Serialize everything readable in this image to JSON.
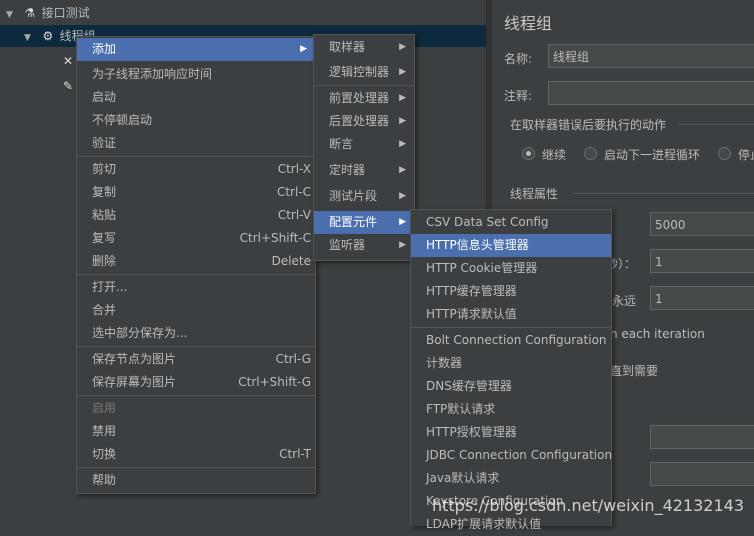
{
  "tree": {
    "root_label": "接口测试",
    "thread_group_label": "线程组"
  },
  "right_panel": {
    "title": "线程组",
    "name_label": "名称:",
    "name_value": "线程组",
    "comment_label": "注释:",
    "error_action_label": "在取样器错误后要执行的动作",
    "radio_continue": "继续",
    "radio_next_loop": "启动下一进程循环",
    "radio_stop": "停止",
    "thread_props_label": "线程属性",
    "threads_value": "5000",
    "ramp_label_partial": "秒）：",
    "ramp_value": "1",
    "loop_label_partial": "永远",
    "loop_value": "1",
    "same_user_partial": "n each iteration",
    "delay_partial": "直到需要"
  },
  "menu1": {
    "items": [
      {
        "label": "添加",
        "shortcut": "",
        "submenu": true,
        "highlight": true
      },
      {
        "label": "为子线程添加响应时间",
        "shortcut": ""
      },
      {
        "label": "启动",
        "shortcut": ""
      },
      {
        "label": "不停顿启动",
        "shortcut": ""
      },
      {
        "label": "验证",
        "shortcut": ""
      },
      {
        "label": "剪切",
        "shortcut": "Ctrl-X"
      },
      {
        "label": "复制",
        "shortcut": "Ctrl-C"
      },
      {
        "label": "粘贴",
        "shortcut": "Ctrl-V"
      },
      {
        "label": "复写",
        "shortcut": "Ctrl+Shift-C"
      },
      {
        "label": "删除",
        "shortcut": "Delete"
      },
      {
        "label": "打开...",
        "shortcut": ""
      },
      {
        "label": "合并",
        "shortcut": ""
      },
      {
        "label": "选中部分保存为...",
        "shortcut": ""
      },
      {
        "label": "保存节点为图片",
        "shortcut": "Ctrl-G"
      },
      {
        "label": "保存屏幕为图片",
        "shortcut": "Ctrl+Shift-G"
      },
      {
        "label": "启用",
        "shortcut": "",
        "disabled": true
      },
      {
        "label": "禁用",
        "shortcut": ""
      },
      {
        "label": "切换",
        "shortcut": "Ctrl-T"
      },
      {
        "label": "帮助",
        "shortcut": ""
      }
    ]
  },
  "menu2": {
    "items": [
      {
        "label": "取样器"
      },
      {
        "label": "逻辑控制器"
      },
      {
        "label": "前置处理器"
      },
      {
        "label": "后置处理器"
      },
      {
        "label": "断言"
      },
      {
        "label": "定时器"
      },
      {
        "label": "测试片段"
      },
      {
        "label": "配置元件",
        "highlight": true
      },
      {
        "label": "监听器"
      }
    ]
  },
  "menu3": {
    "items": [
      {
        "label": "CSV Data Set Config"
      },
      {
        "label": "HTTP信息头管理器",
        "highlight": true
      },
      {
        "label": "HTTP Cookie管理器"
      },
      {
        "label": "HTTP缓存管理器"
      },
      {
        "label": "HTTP请求默认值"
      },
      {
        "label": "Bolt Connection Configuration"
      },
      {
        "label": "计数器"
      },
      {
        "label": "DNS缓存管理器"
      },
      {
        "label": "FTP默认请求"
      },
      {
        "label": "HTTP授权管理器"
      },
      {
        "label": "JDBC Connection Configuration"
      },
      {
        "label": "Java默认请求"
      },
      {
        "label": "Keystore Configuration"
      },
      {
        "label": "LDAP扩展请求默认值"
      }
    ]
  },
  "watermark": "https://blog.csdn.net/weixin_42132143"
}
